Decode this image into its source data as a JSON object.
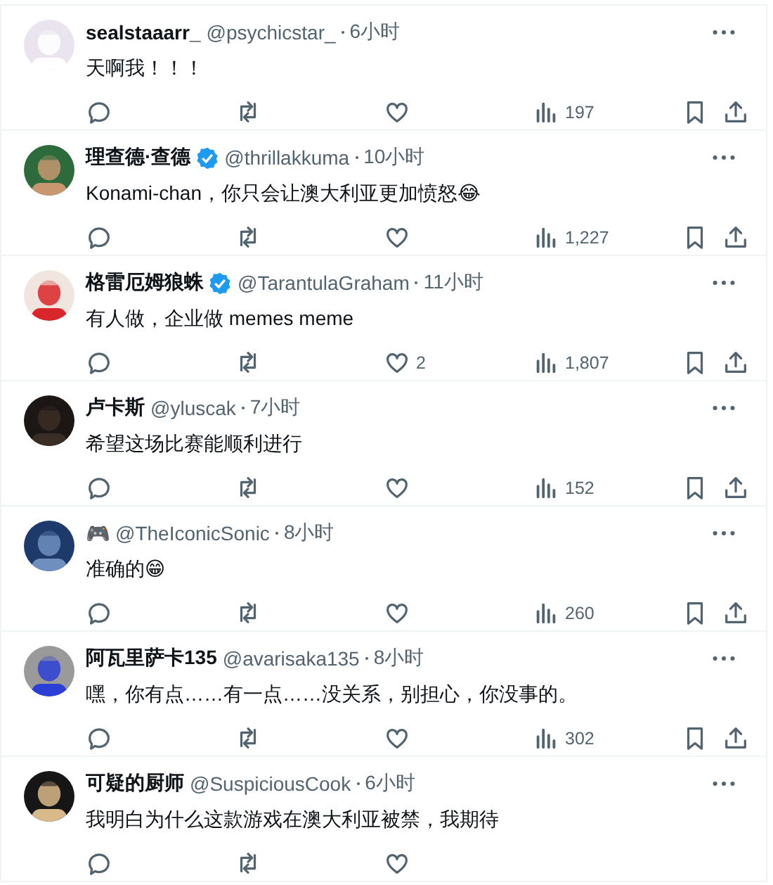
{
  "replies": [
    {
      "display_name": "sealstaaarr_",
      "verified": false,
      "handle": "@psychicstar_",
      "time": "6小时",
      "text": "天啊我！！！",
      "actions": [
        {
          "kind": "reply"
        },
        {
          "kind": "repost"
        },
        {
          "kind": "like"
        },
        {
          "kind": "views",
          "count": "197"
        },
        {
          "kind": "bookmark"
        },
        {
          "kind": "share"
        }
      ]
    },
    {
      "display_name": "理查德·查德",
      "verified": true,
      "handle": "@thrillakkuma",
      "time": "10小时",
      "text": "Konami-chan，你只会让澳大利亚更加愤怒😂",
      "actions": [
        {
          "kind": "reply"
        },
        {
          "kind": "repost"
        },
        {
          "kind": "like"
        },
        {
          "kind": "views",
          "count": "1,227"
        },
        {
          "kind": "bookmark"
        },
        {
          "kind": "share"
        }
      ]
    },
    {
      "display_name": "格雷厄姆狼蛛",
      "verified": true,
      "handle": "@TarantulaGraham",
      "time": "11小时",
      "text": "有人做，企业做 memes meme",
      "actions": [
        {
          "kind": "reply"
        },
        {
          "kind": "repost"
        },
        {
          "kind": "like",
          "count": "2"
        },
        {
          "kind": "views",
          "count": "1,807"
        },
        {
          "kind": "bookmark"
        },
        {
          "kind": "share"
        }
      ]
    },
    {
      "display_name": "卢卡斯",
      "verified": false,
      "handle": "@yluscak",
      "time": "7小时",
      "text": "希望这场比赛能顺利进行",
      "actions": [
        {
          "kind": "reply"
        },
        {
          "kind": "repost"
        },
        {
          "kind": "like"
        },
        {
          "kind": "views",
          "count": "152"
        },
        {
          "kind": "bookmark"
        },
        {
          "kind": "share"
        }
      ]
    },
    {
      "display_name": "🎮",
      "verified": false,
      "handle": "@TheIconicSonic",
      "time": "8小时",
      "text": "准确的😁",
      "actions": [
        {
          "kind": "reply"
        },
        {
          "kind": "repost"
        },
        {
          "kind": "like"
        },
        {
          "kind": "views",
          "count": "260"
        },
        {
          "kind": "bookmark"
        },
        {
          "kind": "share"
        }
      ]
    },
    {
      "display_name": "阿瓦里萨卡135",
      "verified": false,
      "handle": "@avarisaka135",
      "time": "8小时",
      "text": "嘿，你有点……有一点……没关系，别担心，你没事的。",
      "actions": [
        {
          "kind": "reply"
        },
        {
          "kind": "repost"
        },
        {
          "kind": "like"
        },
        {
          "kind": "views",
          "count": "302"
        },
        {
          "kind": "bookmark"
        },
        {
          "kind": "share"
        }
      ]
    },
    {
      "display_name": "可疑的厨师",
      "verified": false,
      "handle": "@SuspiciousCook",
      "time": "6小时",
      "text": "我明白为什么这款游戏在澳大利亚被禁，我期待",
      "actions": [
        {
          "kind": "reply"
        },
        {
          "kind": "repost"
        },
        {
          "kind": "like"
        }
      ]
    }
  ]
}
